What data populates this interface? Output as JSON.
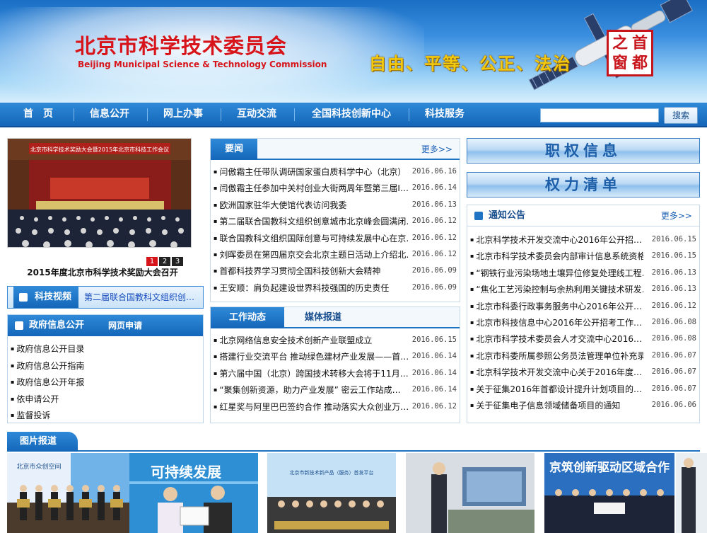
{
  "header": {
    "title": "北京市科学技术委员会",
    "subtitle": "Beijing Municipal Science & Technology Commission",
    "slogan": "自由、平等、公正、法治",
    "seal_text": [
      "首",
      "都",
      "之",
      "窗"
    ]
  },
  "nav": {
    "items": [
      "首　页",
      "信息公开",
      "网上办事",
      "互动交流",
      "全国科技创新中心",
      "科技服务"
    ],
    "search_placeholder": "",
    "search_button": "搜索"
  },
  "hero": {
    "banner_text": "北京市科学技术奖励大会暨2015年北京市科技工作会议",
    "caption": "2015年度北京市科学技术奖励大会召开",
    "pages": [
      "1",
      "2",
      "3"
    ]
  },
  "video": {
    "label": "科技视频",
    "text": "第二届联合国教科文组织创…"
  },
  "gov_info": {
    "title": "政府信息公开",
    "tab2": "网页申请",
    "items": [
      "政府信息公开目录",
      "政府信息公开指南",
      "政府信息公开年报",
      "依申请公开",
      "监督投诉"
    ]
  },
  "news": {
    "tab": "要闻",
    "more": "更多>>",
    "items": [
      {
        "title": "闫傲霜主任带队调研国家蛋白质科学中心（北京）",
        "date": "2016.06.16"
      },
      {
        "title": "闫傲霜主任参加中关村创业大街两周年暨第三届I…",
        "date": "2016.06.14"
      },
      {
        "title": "欧洲国家驻华大使馆代表访问我委",
        "date": "2016.06.13"
      },
      {
        "title": "第二届联合国教科文组织创意城市北京峰会圆满闭…",
        "date": "2016.06.12"
      },
      {
        "title": "联合国教科文组织国际创意与可持续发展中心在京…",
        "date": "2016.06.12"
      },
      {
        "title": "刘晖委员在第四届京交会北京主题日活动上介绍北…",
        "date": "2016.06.12"
      },
      {
        "title": "首都科技界学习贯彻全国科技创新大会精神",
        "date": "2016.06.09"
      },
      {
        "title": "王安顺：肩负起建设世界科技强国的历史责任",
        "date": "2016.06.09"
      }
    ]
  },
  "work": {
    "tab": "工作动态",
    "tab2": "媒体报道",
    "items": [
      {
        "title": "北京网络信息安全技术创新产业联盟成立",
        "date": "2016.06.15"
      },
      {
        "title": "搭建行业交流平台 推动绿色建材产业发展——首…",
        "date": "2016.06.14"
      },
      {
        "title": "第六届中国（北京）跨国技术转移大会将于11月…",
        "date": "2016.06.14"
      },
      {
        "title": "“聚集创新资源，助力产业发展” 密云工作站成…",
        "date": "2016.06.14"
      },
      {
        "title": "红星奖与阿里巴巴签约合作 推动落实大众创业万…",
        "date": "2016.06.12"
      }
    ]
  },
  "power": {
    "btn1": "职权信息",
    "btn2": "权力清单"
  },
  "notice": {
    "title": "通知公告",
    "more": "更多>>",
    "items": [
      {
        "title": "北京科学技术开发交流中心2016年公开招…",
        "date": "2016.06.15"
      },
      {
        "title": "北京市科学技术委员会内部审计信息系统资格…",
        "date": "2016.06.15"
      },
      {
        "title": "“钢铁行业污染场地土壤异位修复处理线工程…",
        "date": "2016.06.13"
      },
      {
        "title": "“焦化工艺污染控制与余热利用关键技术研发…",
        "date": "2016.06.13"
      },
      {
        "title": "北京市科委行政事务服务中心2016年公开…",
        "date": "2016.06.12"
      },
      {
        "title": "北京市科技信息中心2016年公开招考工作…",
        "date": "2016.06.08"
      },
      {
        "title": "北京市科学技术委员会人才交流中心2016…",
        "date": "2016.06.08"
      },
      {
        "title": "北京市科委所属参照公务员法管理单位补充录…",
        "date": "2016.06.07"
      },
      {
        "title": "北京科学技术开发交流中心关于2016年度…",
        "date": "2016.06.07"
      },
      {
        "title": "关于征集2016年首都设计提升计划项目的…",
        "date": "2016.06.07"
      },
      {
        "title": "关于征集电子信息领域储备项目的通知",
        "date": "2016.06.06"
      }
    ]
  },
  "photos": {
    "title": "图片报道",
    "items": [
      {
        "overlay": "北京市众创空间"
      },
      {
        "overlay": "可持续发展"
      },
      {
        "overlay": "北京市新技术新产品（服务）首发平台"
      },
      {
        "overlay": ""
      },
      {
        "overlay": "京筑创新驱动区域合作"
      }
    ]
  },
  "colors": {
    "brand_red": "#d8141b",
    "nav_blue": "#1466b8",
    "slogan_gold": "#f3c90f"
  }
}
